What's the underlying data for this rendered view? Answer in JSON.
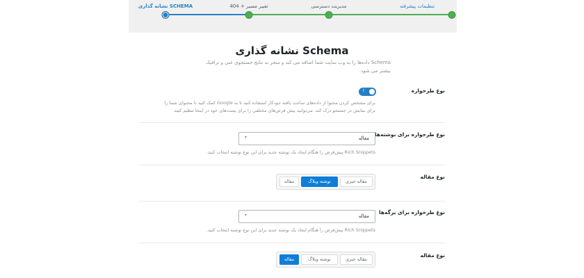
{
  "stepper": {
    "steps": [
      {
        "label": "تنظیمات پیشرفته",
        "state": "done"
      },
      {
        "label": "مدیریت دسترسی",
        "state": "done"
      },
      {
        "label": "404 + تغییر مسیر",
        "state": "done"
      },
      {
        "label": "نشانه گذاری SCHEMA",
        "state": "current"
      }
    ],
    "colors": {
      "done": "#4caf50",
      "current": "#2580c3"
    }
  },
  "header": {
    "title": "نشانه گذاری Schema",
    "description_line1": "Schema داده‌ها را به وب سایت شما اضافه می کند و منجر به نتایج جستجوی غنی و ترافیک",
    "description_line2": "بیشتر می شود."
  },
  "schema_type": {
    "label": "نوع طرحواره",
    "toggle_mark": "I",
    "enabled": true,
    "help_line1": "برای مشخص کردن محتوا از داده‌های ساخت یافته جودکار استفاده کنید تا به Google کمک کنید تا محتوای شما را",
    "help_line2": "برای نمایش در جستجو درک کند. می‌توانید پیش فرض‌های مختلفی را برای پست‌های خود در اینجا تنظیم کنید."
  },
  "posts_schema": {
    "label": "نوع طرحواره برای نوشته‌ها",
    "value": "مقاله",
    "caret": "▾",
    "help": "Rich Snippets پیش‌فرض را هنگام ایجاد یک نوشته جدید برای این نوع نوشته انتخاب کنید."
  },
  "posts_article": {
    "label": "نوع مقاله",
    "options": [
      "مقاله",
      "نوشته وبلاگ",
      "مقاله خبری"
    ],
    "selected": "نوشته وبلاگ"
  },
  "pages_schema": {
    "label": "نوع طرحواره برای برگه‌ها",
    "value": "مقاله",
    "caret": "▾",
    "help": "Rich Snippets پیش‌فرض را هنگام ایجاد یک نوشته جدید برای این نوع نوشته انتخاب کنید."
  },
  "pages_article": {
    "label": "نوع مقاله",
    "options": [
      "مقاله",
      "نوشته وبلاگ",
      "مقاله خبری"
    ],
    "selected": "مقاله"
  }
}
